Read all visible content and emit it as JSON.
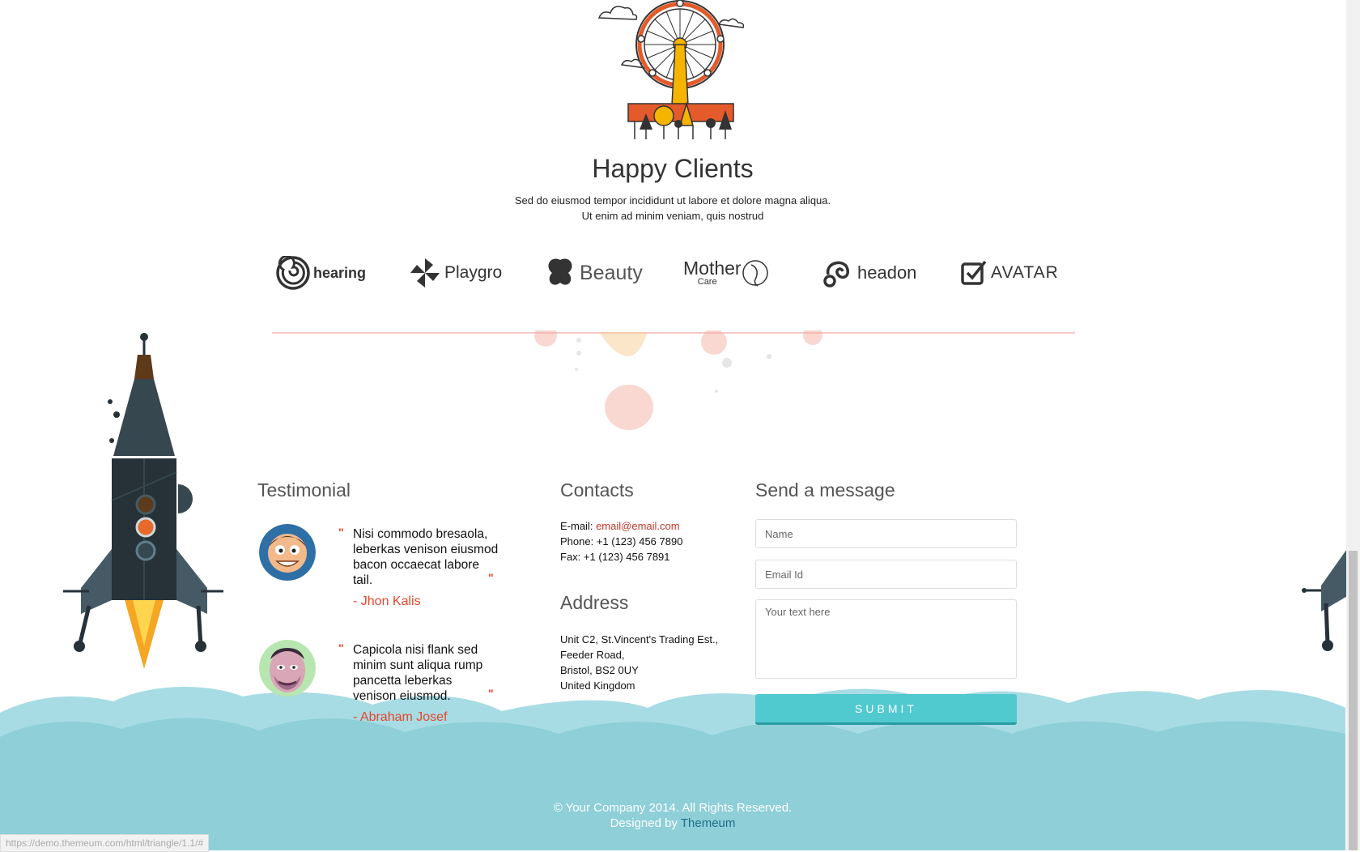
{
  "happy_clients": {
    "title": "Happy Clients",
    "subtitle_line1": "Sed do eiusmod tempor incididunt ut labore et dolore magna aliqua.",
    "subtitle_line2": "Ut enim ad minim veniam, quis nostrud"
  },
  "client_logos": [
    {
      "name": "hearing",
      "icon": "spiral-icon"
    },
    {
      "name": "Playgro",
      "icon": "pinwheel-icon"
    },
    {
      "name": "Beauty",
      "icon": "butterfly-icon"
    },
    {
      "name": "Mother",
      "sub": "Care",
      "icon": "mother-face-icon"
    },
    {
      "name": "headon",
      "icon": "headphones-icon"
    },
    {
      "name": "AVATAR",
      "icon": "checkbox-icon"
    }
  ],
  "testimonial": {
    "title": "Testimonial",
    "items": [
      {
        "quote": "Nisi commodo bresaola, leberkas venison eiusmod bacon occaecat labore tail.",
        "author": "- Jhon Kalis"
      },
      {
        "quote": "Capicola nisi flank sed minim sunt aliqua rump pancetta leberkas venison eiusmod.",
        "author": "- Abraham Josef"
      }
    ]
  },
  "contacts": {
    "title": "Contacts",
    "email_label": "E-mail:",
    "email": "email@email.com",
    "phone": "Phone: +1 (123) 456 7890",
    "fax": "Fax: +1 (123) 456 7891"
  },
  "address": {
    "title": "Address",
    "line1": "Unit C2, St.Vincent's Trading Est.,",
    "line2": "Feeder Road,",
    "line3": "Bristol, BS2 0UY",
    "line4": "United Kingdom"
  },
  "message_form": {
    "title": "Send a message",
    "name_placeholder": "Name",
    "email_placeholder": "Email Id",
    "text_placeholder": "Your text here",
    "submit_label": "SUBMIT"
  },
  "footer": {
    "copyright": "© Your Company 2014. All Rights Reserved.",
    "designed_by": "Designed by",
    "designer": "Themeum"
  },
  "status_bar_url": "https://demo.themeum.com/html/triangle/1.1/#",
  "colors": {
    "accent_red": "#e8452c",
    "submit_teal": "#50c9cf",
    "cloud_blue": "#8ecfd8"
  }
}
